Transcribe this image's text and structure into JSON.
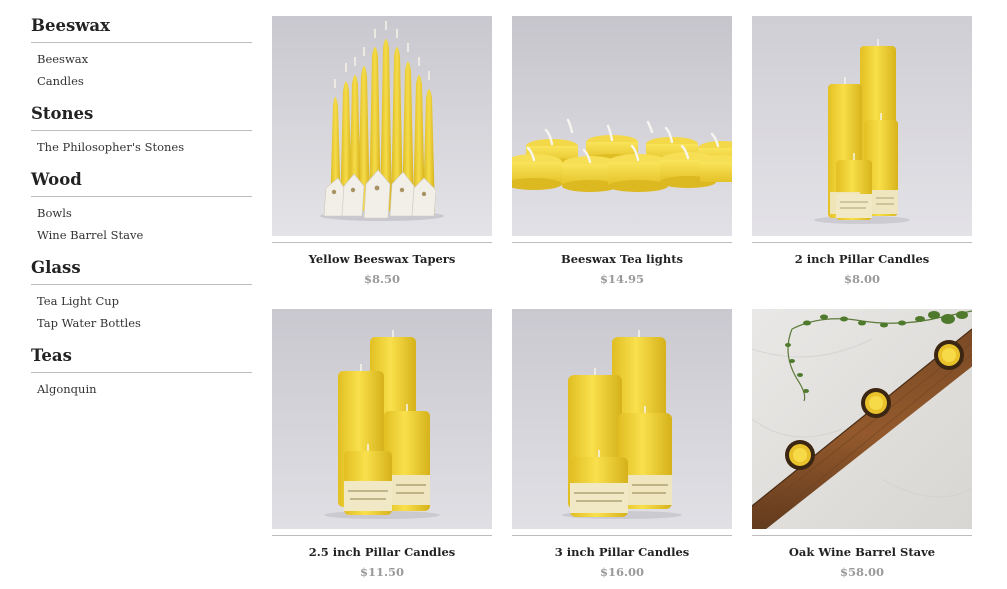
{
  "sidebar": {
    "categories": [
      {
        "title": "Beeswax",
        "items": [
          "Beeswax",
          "Candles"
        ]
      },
      {
        "title": "Stones",
        "items": [
          "The Philosopher's Stones"
        ]
      },
      {
        "title": "Wood",
        "items": [
          "Bowls",
          "Wine Barrel Stave"
        ]
      },
      {
        "title": "Glass",
        "items": [
          "Tea Light Cup",
          "Tap Water Bottles"
        ]
      },
      {
        "title": "Teas",
        "items": [
          "Algonquin"
        ]
      }
    ]
  },
  "products": [
    {
      "name": "Yellow Beeswax Tapers",
      "price": "$8.50"
    },
    {
      "name": "Beeswax Tea lights",
      "price": "$14.95"
    },
    {
      "name": "2 inch Pillar Candles",
      "price": "$8.00"
    },
    {
      "name": "2.5 inch Pillar Candles",
      "price": "$11.50"
    },
    {
      "name": "3 inch Pillar Candles",
      "price": "$16.00"
    },
    {
      "name": "Oak Wine Barrel Stave",
      "price": "$58.00"
    }
  ],
  "colors": {
    "candle_yellow": "#f2d53c",
    "photo_background": "#d6d5da",
    "price_gray": "#9a9a9a",
    "divider": "#bdbdbd"
  }
}
